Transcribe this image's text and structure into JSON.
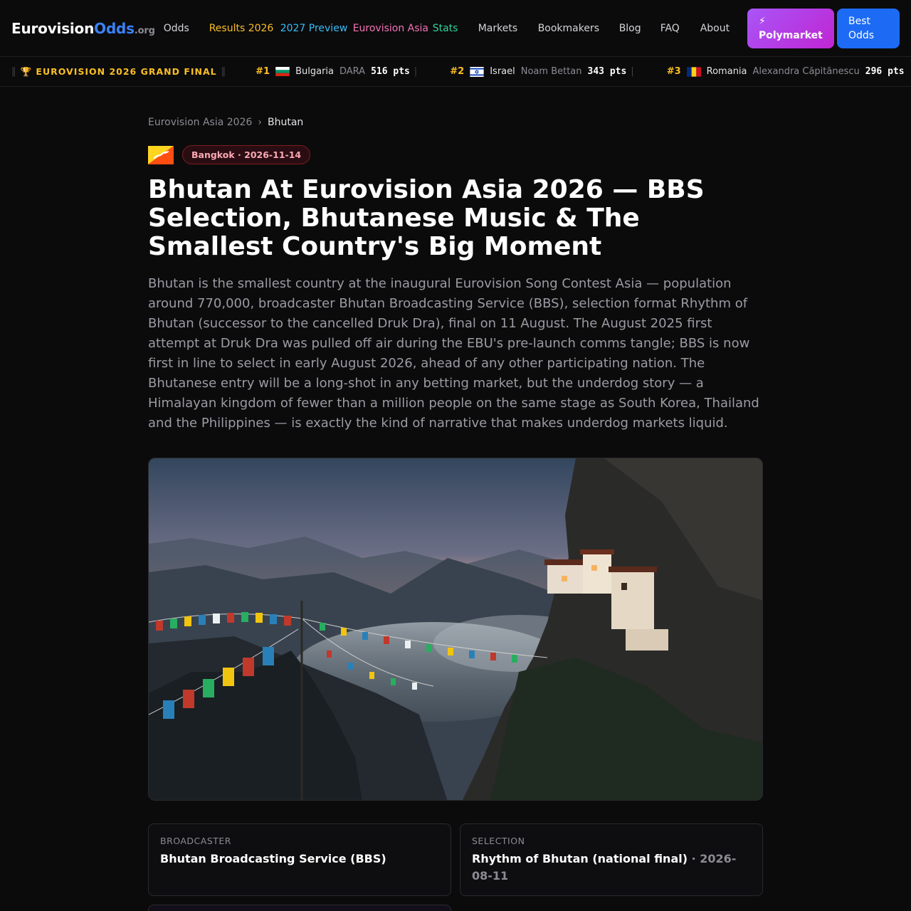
{
  "header": {
    "logo": {
      "part1": "Eurovision",
      "part2": "Odds",
      "tld": ".org"
    },
    "nav": [
      {
        "label": "Odds",
        "color": "#d4d4d8"
      },
      {
        "label": "Results 2026",
        "color": "#fbbf24"
      },
      {
        "label": "2027 Preview",
        "color": "#38bdf8"
      },
      {
        "label": "Eurovision Asia",
        "color": "#f472b6"
      },
      {
        "label": "Stats",
        "color": "#34d399"
      },
      {
        "label": "Markets",
        "color": "#d4d4d8"
      },
      {
        "label": "Bookmakers",
        "color": "#d4d4d8"
      },
      {
        "label": "Blog",
        "color": "#d4d4d8"
      },
      {
        "label": "FAQ",
        "color": "#d4d4d8"
      },
      {
        "label": "About",
        "color": "#d4d4d8"
      }
    ],
    "polymarket_label": "⚡ Polymarket",
    "best_odds_label": "Best Odds"
  },
  "ticker": {
    "headline": "🏆 EUROVISION 2026 GRAND FINAL",
    "items": [
      {
        "rank": "#1",
        "flag": "bulgaria-flag",
        "country": "Bulgaria",
        "artist": "DARA",
        "points": "516 pts"
      },
      {
        "rank": "#2",
        "flag": "israel-flag",
        "country": "Israel",
        "artist": "Noam Bettan",
        "points": "343 pts"
      },
      {
        "rank": "#3",
        "flag": "romania-flag",
        "country": "Romania",
        "artist": "Alexandra Căpitănescu",
        "points": "296 pts"
      }
    ]
  },
  "breadcrumb": {
    "parent": "Eurovision Asia 2026",
    "separator": "›",
    "current": "Bhutan"
  },
  "article": {
    "flag": "bhutan-flag",
    "badge": "Bangkok · 2026-11-14",
    "title": "Bhutan At Eurovision Asia 2026 — BBS Selection, Bhutanese Music & The Smallest Country's Big Moment",
    "lead": "Bhutan is the smallest country at the inaugural Eurovision Song Contest Asia — population around 770,000, broadcaster Bhutan Broadcasting Service (BBS), selection format Rhythm of Bhutan (successor to the cancelled Druk Dra), final on 11 August. The August 2025 first attempt at Druk Dra was pulled off air during the EBU's pre-launch comms tangle; BBS is now first in line to select in early August 2026, ahead of any other participating nation. The Bhutanese entry will be a long-shot in any betting market, but the underdog story — a Himalayan kingdom of fewer than a million people on the same stage as South Korea, Thailand and the Philippines — is exactly the kind of narrative that makes underdog markets liquid.",
    "hero_image": "tigers-nest-monastery-with-prayer-flags"
  },
  "cards": [
    {
      "label": "Broadcaster",
      "value": "Bhutan Broadcasting Service (BBS)",
      "date": ""
    },
    {
      "label": "Selection",
      "value": "Rhythm of Bhutan (national final)",
      "date": " · 2026-08-11"
    }
  ]
}
